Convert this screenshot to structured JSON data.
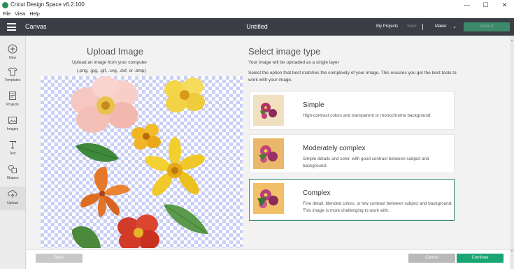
{
  "window": {
    "title": "Cricut Design Space  v6.2.100",
    "minimize_glyph": "—",
    "maximize_glyph": "☐",
    "close_glyph": "✕"
  },
  "menu": [
    "File",
    "View",
    "Help"
  ],
  "header": {
    "section": "Canvas",
    "document_title": "Untitled",
    "my_projects": "My Projects",
    "save": "Save",
    "machine": "Maker",
    "make_it": "Make It"
  },
  "sidebar": {
    "items": [
      {
        "label": "New",
        "icon": "plus-icon"
      },
      {
        "label": "Templates",
        "icon": "tshirt-icon"
      },
      {
        "label": "Projects",
        "icon": "projects-icon"
      },
      {
        "label": "Images",
        "icon": "images-icon"
      },
      {
        "label": "Text",
        "icon": "text-icon"
      },
      {
        "label": "Shapes",
        "icon": "shapes-icon"
      },
      {
        "label": "Upload",
        "icon": "upload-icon"
      }
    ]
  },
  "upload": {
    "heading": "Upload Image",
    "line1": "Upload an image from your computer",
    "line2": "(.png, .jpg, .gif, .svg, .dxf, or .bmp)"
  },
  "select": {
    "heading": "Select image type",
    "subheading": "Your image will be uploaded as a single layer",
    "description": "Select the option that best matches the complexity of your image. This ensures you get the best tools to work with your image.",
    "options": [
      {
        "title": "Simple",
        "description": "High-contrast colors and transparent or monochrome background.",
        "selected": false
      },
      {
        "title": "Moderately complex",
        "description": "Simple details and color, with good contrast between subject and background.",
        "selected": false
      },
      {
        "title": "Complex",
        "description": "Fine detail, blended colors, or low contrast between subject and background. This image is more challenging to work with.",
        "selected": true
      }
    ]
  },
  "footer": {
    "back": "Back",
    "cancel": "Cancel",
    "continue": "Continue"
  },
  "colors": {
    "header_bg": "#3b3f45",
    "accent_green": "#18a572",
    "selected_border": "#3d8a6a",
    "checker": "#c9cff5"
  }
}
